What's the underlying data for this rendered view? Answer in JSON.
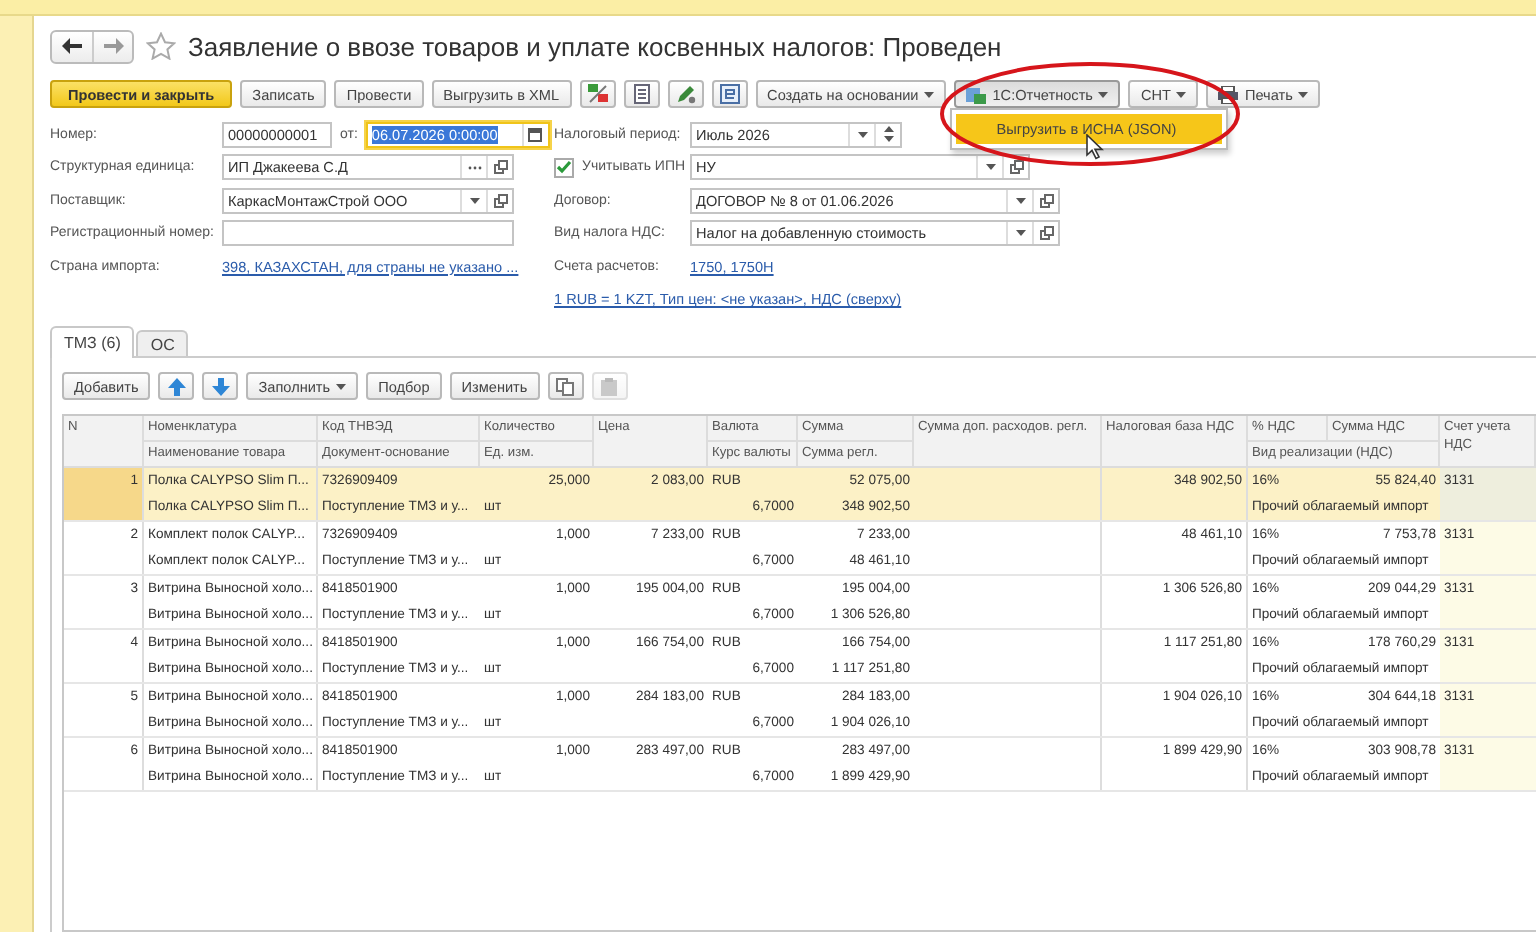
{
  "title": "Заявление о ввозе товаров и уплате косвенных налогов: Проведен",
  "toolbar": [
    {
      "kind": "primary",
      "label": "Провести и закрыть"
    },
    {
      "kind": "button",
      "label": "Записать"
    },
    {
      "kind": "button",
      "label": "Провести"
    },
    {
      "kind": "button",
      "label": "Выгрузить в XML"
    },
    {
      "kind": "icon"
    },
    {
      "kind": "icon"
    },
    {
      "kind": "icon"
    },
    {
      "kind": "icon"
    },
    {
      "kind": "menu",
      "label": "Создать на основании",
      "pressed": false
    },
    {
      "kind": "menu",
      "label": "1С:Отчетность",
      "pressed": true,
      "dropdown": [
        {
          "label": "Выгрузить в ИСНА (JSON)",
          "selected": true
        }
      ]
    },
    {
      "kind": "menu",
      "label": "СНТ",
      "pressed": false
    },
    {
      "kind": "menu",
      "label": "Печать",
      "pressed": false
    }
  ],
  "form": {
    "number": {
      "label": "Номер:",
      "value": "00000000001"
    },
    "date": {
      "label": "от:",
      "value": "06.07.2026  0:00:00",
      "focused": true
    },
    "tax_period": {
      "label": "Налоговый период:",
      "value": "Июль 2026"
    },
    "unit": {
      "label": "Структурная единица:",
      "value": "ИП Джакеева С.Д"
    },
    "ipn": {
      "label": "Учитывать ИПН",
      "checked": true,
      "value": "НУ"
    },
    "supplier": {
      "label": "Поставщик:",
      "value": "КаркасМонтажСтрой ООО"
    },
    "contract": {
      "label": "Договор:",
      "value": "ДОГОВОР № 8 от 01.06.2026"
    },
    "reg_number": {
      "label": "Регистрационный номер:"
    },
    "vat_kind": {
      "label": "Вид налога НДС:",
      "value": "Налог на добавленную стоимость"
    },
    "country": {
      "label": "Страна импорта:",
      "link": "398, КАЗАХСТАН, для страны не указано ..."
    },
    "accounts": {
      "label": "Счета расчетов:",
      "link": "1750, 1750Н"
    },
    "prices_link": "1 RUB = 1 KZT, Тип цен: <не указан>, НДС (сверху)"
  },
  "tabs": [
    {
      "label": "ТМЗ (6)",
      "selected": true
    },
    {
      "label": "ОС",
      "selected": false
    }
  ],
  "table_toolbar": [
    {
      "kind": "button",
      "label": "Добавить"
    },
    {
      "kind": "icon"
    },
    {
      "kind": "icon"
    },
    {
      "kind": "menu",
      "label": "Заполнить"
    },
    {
      "kind": "button",
      "label": "Подбор"
    },
    {
      "kind": "button",
      "label": "Изменить"
    },
    {
      "kind": "icon"
    },
    {
      "kind": "icon",
      "disabled": true
    }
  ],
  "table": {
    "header": [
      "N",
      "Номенклатура",
      "Код ТНВЭД",
      "Количество",
      "Цена",
      "Валюта",
      "Сумма",
      "Сумма доп. расходов. регл.",
      "Налоговая база НДС",
      "% НДС",
      "Сумма НДС",
      "Счет учета НДС",
      "Наименование товара",
      "Документ-основание",
      "Ед. изм.",
      "Курс валюты",
      "Сумма регл.",
      "Вид реализации (НДС)"
    ],
    "rows": [
      {
        "n": "1",
        "selected": true,
        "nomenclature": "Полка CALYPSO Slim П...",
        "name": "Полка CALYPSO Slim П...",
        "code": "7326909409",
        "document": "Поступление ТМЗ и у...",
        "qty": "25,000",
        "unit": "шт",
        "price": "2 083,00",
        "currency": "RUB",
        "rate": "6,7000",
        "sum": "52 075,00",
        "sum_reg": "348 902,50",
        "tax_base": "348 902,50",
        "vat_rate": "16%",
        "vat_sum": "55 824,40",
        "sale_kind": "Прочий облагаемый импорт",
        "account": "3131"
      },
      {
        "n": "2",
        "selected": false,
        "nomenclature": "Комплект полок CALYP...",
        "name": "Комплект полок CALYP...",
        "code": "7326909409",
        "document": "Поступление ТМЗ и у...",
        "qty": "1,000",
        "unit": "шт",
        "price": "7 233,00",
        "currency": "RUB",
        "rate": "6,7000",
        "sum": "7 233,00",
        "sum_reg": "48 461,10",
        "tax_base": "48 461,10",
        "vat_rate": "16%",
        "vat_sum": "7 753,78",
        "sale_kind": "Прочий облагаемый импорт",
        "account": "3131"
      },
      {
        "n": "3",
        "selected": false,
        "nomenclature": "Витрина Выносной холо...",
        "name": "Витрина Выносной холо...",
        "code": "8418501900",
        "document": "Поступление ТМЗ и у...",
        "qty": "1,000",
        "unit": "шт",
        "price": "195 004,00",
        "currency": "RUB",
        "rate": "6,7000",
        "sum": "195 004,00",
        "sum_reg": "1 306 526,80",
        "tax_base": "1 306 526,80",
        "vat_rate": "16%",
        "vat_sum": "209 044,29",
        "sale_kind": "Прочий облагаемый импорт",
        "account": "3131"
      },
      {
        "n": "4",
        "selected": false,
        "nomenclature": "Витрина Выносной холо...",
        "name": "Витрина Выносной холо...",
        "code": "8418501900",
        "document": "Поступление ТМЗ и у...",
        "qty": "1,000",
        "unit": "шт",
        "price": "166 754,00",
        "currency": "RUB",
        "rate": "6,7000",
        "sum": "166 754,00",
        "sum_reg": "1 117 251,80",
        "tax_base": "1 117 251,80",
        "vat_rate": "16%",
        "vat_sum": "178 760,29",
        "sale_kind": "Прочий облагаемый импорт",
        "account": "3131"
      },
      {
        "n": "5",
        "selected": false,
        "nomenclature": "Витрина Выносной холо...",
        "name": "Витрина Выносной холо...",
        "code": "8418501900",
        "document": "Поступление ТМЗ и у...",
        "qty": "1,000",
        "unit": "шт",
        "price": "284 183,00",
        "currency": "RUB",
        "rate": "6,7000",
        "sum": "284 183,00",
        "sum_reg": "1 904 026,10",
        "tax_base": "1 904 026,10",
        "vat_rate": "16%",
        "vat_sum": "304 644,18",
        "sale_kind": "Прочий облагаемый импорт",
        "account": "3131"
      },
      {
        "n": "6",
        "selected": false,
        "nomenclature": "Витрина Выносной холо...",
        "name": "Витрина Выносной холо...",
        "code": "8418501900",
        "document": "Поступление ТМЗ и у...",
        "qty": "1,000",
        "unit": "шт",
        "price": "283 497,00",
        "currency": "RUB",
        "rate": "6,7000",
        "sum": "283 497,00",
        "sum_reg": "1 899 429,90",
        "tax_base": "1 899 429,90",
        "vat_rate": "16%",
        "vat_sum": "303 908,78",
        "sale_kind": "Прочий облагаемый импорт",
        "account": "3131"
      }
    ]
  }
}
